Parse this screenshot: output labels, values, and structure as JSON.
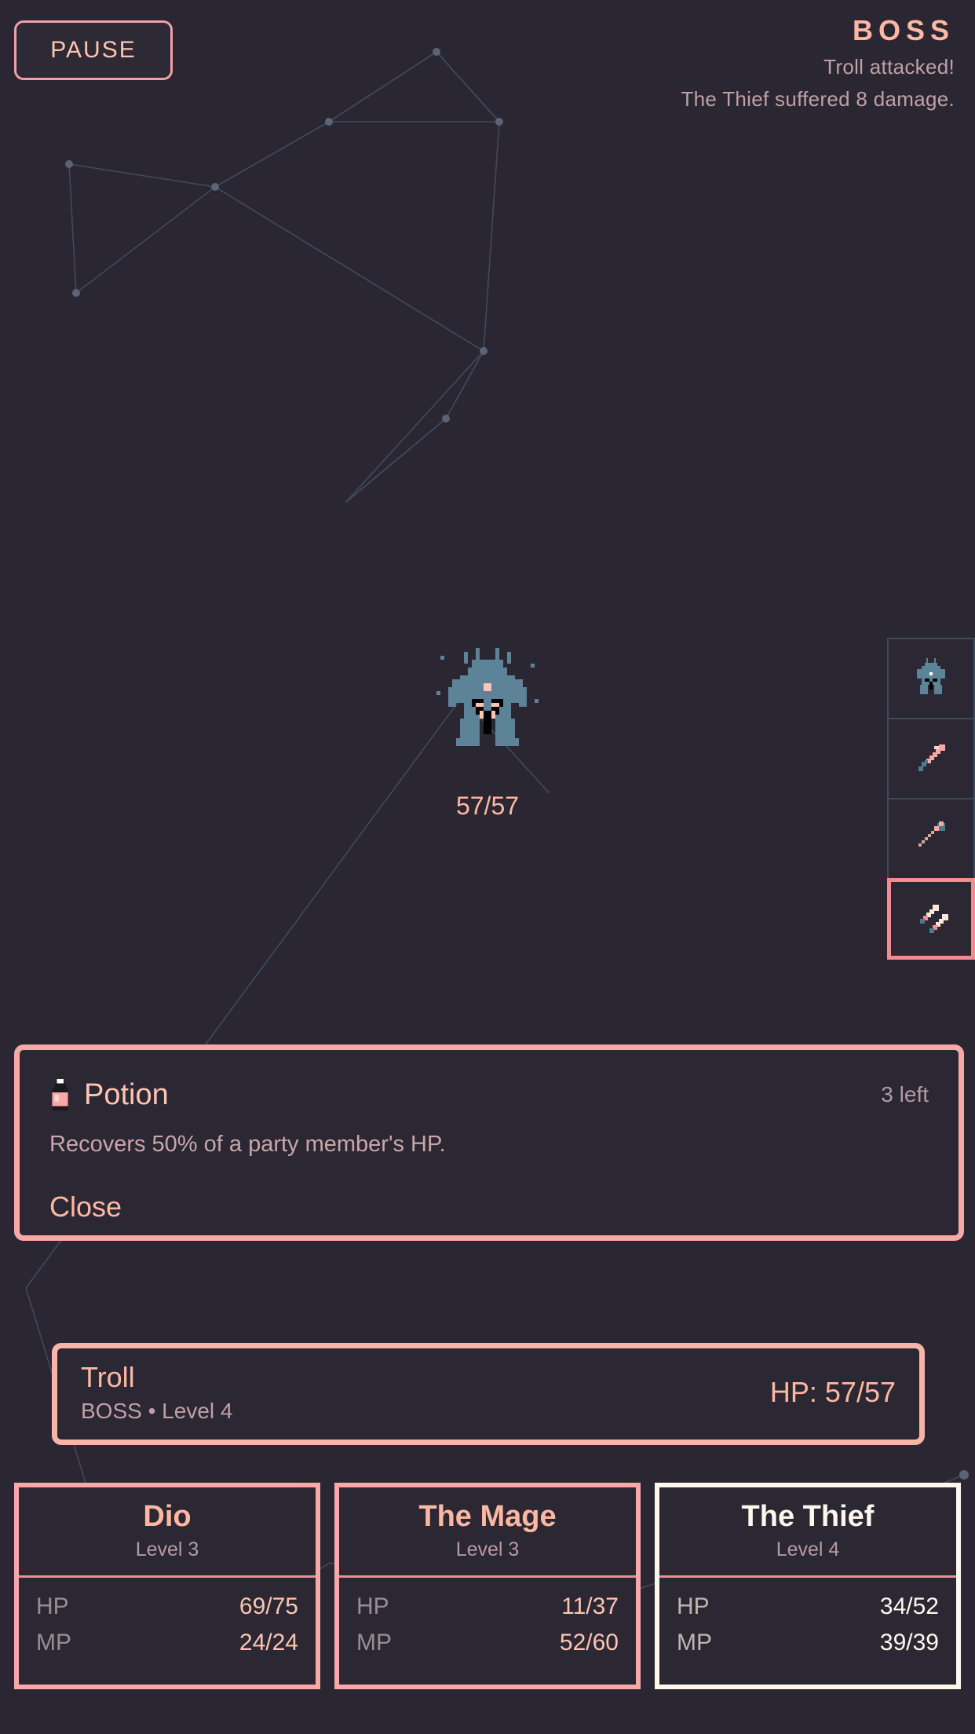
{
  "pause": {
    "label": "PAUSE"
  },
  "boss_header": {
    "title": "BOSS",
    "log": [
      "Troll attacked!",
      "The Thief suffered 8 damage."
    ]
  },
  "enemy": {
    "sprite_icon": "troll-sprite",
    "hp_text": "57/57",
    "name": "Troll",
    "subtitle": "BOSS • Level 4",
    "hp_label": "HP: 57/57"
  },
  "action_rail": {
    "slots": [
      {
        "icon": "troll-enemy-icon",
        "selected": false
      },
      {
        "icon": "sword-icon",
        "selected": false
      },
      {
        "icon": "staff-icon",
        "selected": false
      },
      {
        "icon": "daggers-icon",
        "selected": true
      }
    ]
  },
  "item_dialog": {
    "icon": "potion-bottle-icon",
    "name": "Potion",
    "count_label": "3 left",
    "description": "Recovers 50% of a party member's HP.",
    "close_label": "Close"
  },
  "party": {
    "members": [
      {
        "name": "Dio",
        "level": "Level 3",
        "selected": false,
        "stats": [
          {
            "label": "HP",
            "value": "69/75"
          },
          {
            "label": "MP",
            "value": "24/24"
          }
        ]
      },
      {
        "name": "The Mage",
        "level": "Level 3",
        "selected": false,
        "stats": [
          {
            "label": "HP",
            "value": "11/37"
          },
          {
            "label": "MP",
            "value": "52/60"
          }
        ]
      },
      {
        "name": "The Thief",
        "level": "Level 4",
        "selected": true,
        "stats": [
          {
            "label": "HP",
            "value": "34/52"
          },
          {
            "label": "MP",
            "value": "39/39"
          }
        ]
      }
    ]
  },
  "colors": {
    "background": "#2a2733",
    "panel": "#2b2834",
    "accent_pink": "#f9a8a8",
    "accent_salmon": "#ffb7a3",
    "muted": "#bfa0a6",
    "selected_white": "#fdf7ec",
    "constellation_line": "#4a5569",
    "sprite_blue": "#5d8399"
  }
}
